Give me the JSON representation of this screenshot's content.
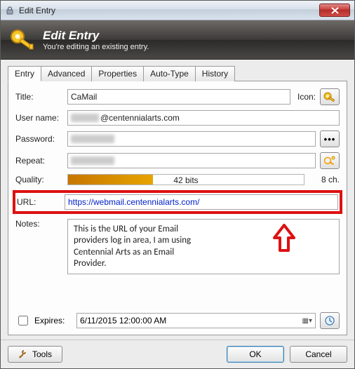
{
  "window": {
    "title": "Edit Entry"
  },
  "header": {
    "title": "Edit Entry",
    "subtitle": "You're editing an existing entry."
  },
  "tabs": [
    "Entry",
    "Advanced",
    "Properties",
    "Auto-Type",
    "History"
  ],
  "active_tab": 0,
  "labels": {
    "title": "Title:",
    "icon": "Icon:",
    "username": "User name:",
    "password": "Password:",
    "repeat": "Repeat:",
    "quality": "Quality:",
    "url": "URL:",
    "notes": "Notes:",
    "expires": "Expires:"
  },
  "fields": {
    "title": "CaMail",
    "username_suffix": "@centennialarts.com",
    "quality_bits": "42 bits",
    "quality_ch": "8 ch.",
    "url": "https://webmail.centennialarts.com/",
    "expires": "6/11/2015 12:00:00 AM"
  },
  "annotation": {
    "text": "This is the URL of your Email providers log in area, I am using Centennial Arts as an Email Provider."
  },
  "footer": {
    "tools": "Tools",
    "ok": "OK",
    "cancel": "Cancel"
  }
}
